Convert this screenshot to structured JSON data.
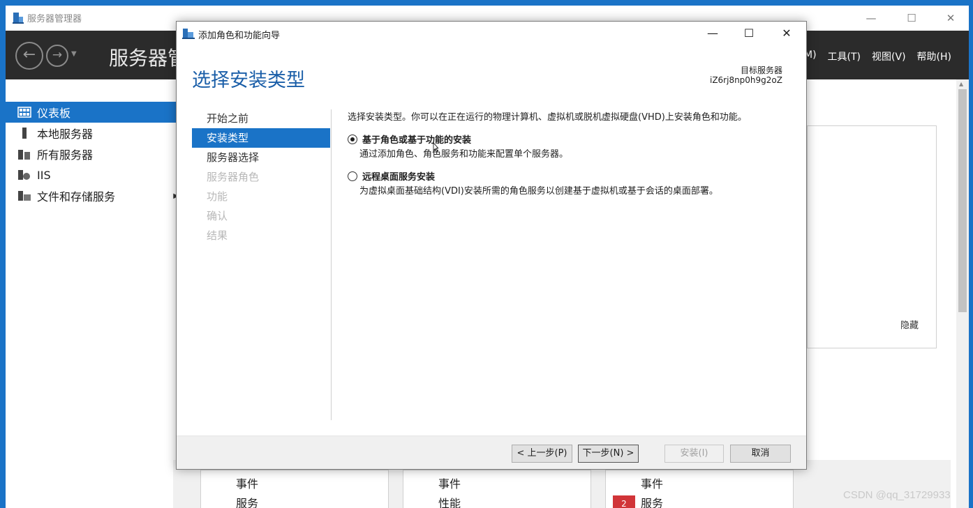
{
  "server_manager": {
    "title": "服务器管理器",
    "header_title": "服务器管",
    "menus": [
      "M)",
      "工具(T)",
      "视图(V)",
      "帮助(H)"
    ],
    "sidebar": [
      {
        "label": "仪表板",
        "icon": "dashboard-icon",
        "active": true
      },
      {
        "label": "本地服务器",
        "icon": "server-icon",
        "active": false
      },
      {
        "label": "所有服务器",
        "icon": "servers-icon",
        "active": false
      },
      {
        "label": "IIS",
        "icon": "iis-icon",
        "active": false
      },
      {
        "label": "文件和存储服务",
        "icon": "storage-icon",
        "active": false
      }
    ],
    "hide_label": "隐藏",
    "tiles": [
      {
        "events": "事件",
        "second": "服务"
      },
      {
        "events": "事件",
        "second": "性能"
      },
      {
        "events": "事件",
        "second": "服务",
        "badge": "2"
      }
    ]
  },
  "wizard": {
    "title": "添加角色和功能向导",
    "heading": "选择安装类型",
    "target_label": "目标服务器",
    "target_value": "iZ6rj8np0h9g2oZ",
    "steps": [
      {
        "label": "开始之前",
        "state": "normal"
      },
      {
        "label": "安装类型",
        "state": "active"
      },
      {
        "label": "服务器选择",
        "state": "normal"
      },
      {
        "label": "服务器角色",
        "state": "disabled"
      },
      {
        "label": "功能",
        "state": "disabled"
      },
      {
        "label": "确认",
        "state": "disabled"
      },
      {
        "label": "结果",
        "state": "disabled"
      }
    ],
    "description": "选择安装类型。你可以在正在运行的物理计算机、虚拟机或脱机虚拟硬盘(VHD)上安装角色和功能。",
    "options": [
      {
        "title": "基于角色或基于功能的安装",
        "desc": "通过添加角色、角色服务和功能来配置单个服务器。",
        "checked": true
      },
      {
        "title": "远程桌面服务安装",
        "desc": "为虚拟桌面基础结构(VDI)安装所需的角色服务以创建基于虚拟机或基于会话的桌面部署。",
        "checked": false
      }
    ],
    "buttons": {
      "prev": "< 上一步(P)",
      "next": "下一步(N) >",
      "install": "安装(I)",
      "cancel": "取消"
    }
  },
  "watermark": "CSDN @qq_31729933",
  "colors": {
    "accent": "#1a73c7",
    "heading": "#1a5ea8",
    "header_bg": "#2b2b2b",
    "badge": "#d13438"
  }
}
